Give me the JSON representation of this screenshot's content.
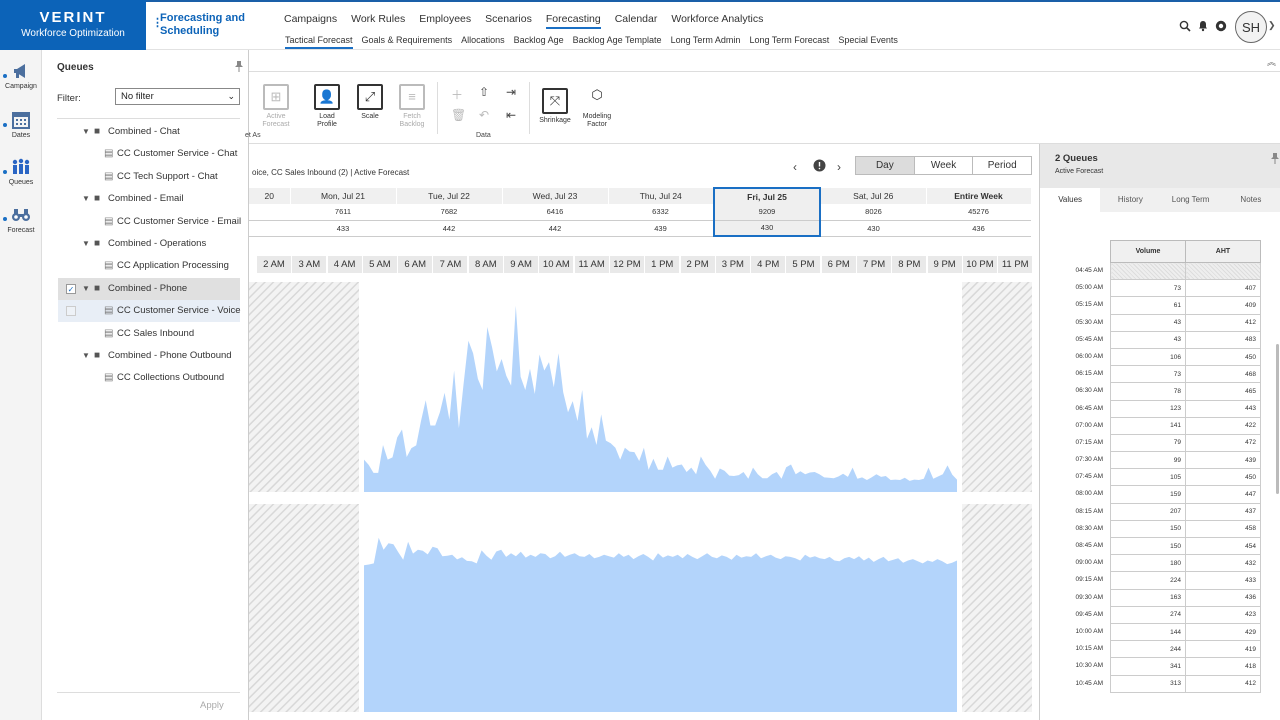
{
  "brand": {
    "name": "VERINT",
    "product": "Workforce Optimization"
  },
  "app_title": [
    "Forecasting and",
    "Scheduling"
  ],
  "main_nav": [
    "Campaigns",
    "Work Rules",
    "Employees",
    "Scenarios",
    "Forecasting",
    "Calendar",
    "Workforce Analytics"
  ],
  "main_nav_active": "Forecasting",
  "sub_nav": [
    "Tactical Forecast",
    "Goals & Requirements",
    "Allocations",
    "Backlog Age",
    "Backlog Age Template",
    "Long Term Admin",
    "Long Term Forecast",
    "Special Events"
  ],
  "sub_nav_active": "Tactical Forecast",
  "user_initials": "SH",
  "rail": [
    {
      "label": "Campaign",
      "icon": "megaphone-icon"
    },
    {
      "label": "Dates",
      "icon": "calendar-icon"
    },
    {
      "label": "Queues",
      "icon": "people-icon"
    },
    {
      "label": "Forecast",
      "icon": "binoculars-icon"
    }
  ],
  "queues": {
    "title": "Queues",
    "filter_label": "Filter:",
    "filter_value": "No filter",
    "apply_label": "Apply",
    "tree": [
      {
        "label": "Combined - Chat",
        "level": 0
      },
      {
        "label": "CC Customer Service - Chat",
        "level": 1
      },
      {
        "label": "CC Tech Support - Chat",
        "level": 1
      },
      {
        "label": "Combined - Email",
        "level": 0
      },
      {
        "label": "CC Customer Service - Email",
        "level": 1
      },
      {
        "label": "Combined - Operations",
        "level": 0
      },
      {
        "label": "CC Application Processing",
        "level": 1
      },
      {
        "label": "Combined - Phone",
        "level": 0,
        "checked": true
      },
      {
        "label": "CC Customer Service - Voice",
        "level": 1
      },
      {
        "label": "CC Sales Inbound",
        "level": 1
      },
      {
        "label": "Combined - Phone Outbound",
        "level": 0
      },
      {
        "label": "CC Collections Outbound",
        "level": 1
      }
    ]
  },
  "ribbon": {
    "set_as_fragment": "et As",
    "active_forecast": [
      "Active",
      "Forecast"
    ],
    "load_profile": [
      "Load",
      "Profile"
    ],
    "scale": "Scale",
    "fetch_backlog": [
      "Fetch",
      "Backlog"
    ],
    "data_group": "Data",
    "shrinkage": "Shrinkage",
    "modeling_factor": [
      "Modeling",
      "Factor"
    ]
  },
  "breadcrumb": "oice, CC Sales Inbound (2) | Active Forecast",
  "view_modes": [
    "Day",
    "Week",
    "Period"
  ],
  "view_mode_active": "Day",
  "week_table": {
    "headers": [
      "20",
      "Mon, Jul 21",
      "Tue, Jul 22",
      "Wed, Jul 23",
      "Thu, Jul 24",
      "Fri, Jul 25",
      "Sat, Jul 26",
      "Entire Week"
    ],
    "volume": [
      "",
      "7611",
      "7682",
      "6416",
      "6332",
      "9209",
      "8026",
      "45276"
    ],
    "aht": [
      "",
      "433",
      "442",
      "442",
      "439",
      "430",
      "430",
      "436"
    ],
    "selected_index": 5
  },
  "hours": [
    "2 AM",
    "3 AM",
    "4 AM",
    "5 AM",
    "6 AM",
    "7 AM",
    "8 AM",
    "9 AM",
    "10 AM",
    "11 AM",
    "12 PM",
    "1 PM",
    "2 PM",
    "3 PM",
    "4 PM",
    "5 PM",
    "6 PM",
    "7 PM",
    "8 PM",
    "9 PM",
    "10 PM",
    "11 PM"
  ],
  "chart_data": [
    {
      "type": "area",
      "x_start": "5:00 AM",
      "x_end": "9:45 PM",
      "x_step_minutes": 15,
      "color": "#b3d4fb",
      "values": [
        73,
        61,
        43,
        43,
        106,
        73,
        78,
        123,
        141,
        79,
        99,
        105,
        159,
        207,
        150,
        150,
        180,
        224,
        163,
        274,
        144,
        244,
        341,
        313,
        255,
        230,
        372,
        326,
        272,
        300,
        262,
        240,
        420,
        260,
        230,
        278,
        221,
        310,
        274,
        293,
        236,
        313,
        225,
        180,
        205,
        160,
        230,
        120,
        146,
        106,
        175,
        116,
        110,
        100,
        73,
        100,
        91,
        90,
        70,
        100,
        50,
        75,
        50,
        50,
        80,
        55,
        60,
        62,
        45,
        55,
        40,
        80,
        61,
        48,
        30,
        53,
        48,
        37,
        36,
        38,
        45,
        30,
        55,
        40,
        31,
        31,
        40,
        45,
        30,
        56,
        62,
        40,
        47,
        40,
        44,
        45,
        40,
        33,
        32,
        31,
        35,
        41,
        34,
        55,
        30,
        33,
        27,
        33,
        40,
        34,
        36,
        27,
        28,
        27,
        32,
        25,
        28,
        27,
        30,
        55,
        30,
        35,
        40,
        60,
        39,
        28
      ],
      "ylim": [
        0,
        460
      ]
    },
    {
      "type": "area",
      "x_start": "5:00 AM",
      "x_end": "9:45 PM",
      "x_step_minutes": 15,
      "color": "#b3d4fb",
      "values": [
        407,
        409,
        412,
        483,
        450,
        468,
        465,
        443,
        422,
        472,
        439,
        450,
        447,
        437,
        458,
        454,
        432,
        433,
        436,
        423,
        429,
        419,
        418,
        412,
        448,
        433,
        422,
        445,
        450,
        430,
        440,
        432,
        444,
        428,
        436,
        430,
        440,
        438,
        426,
        432,
        444,
        430,
        436,
        440,
        432,
        430,
        438,
        426,
        430,
        436,
        432,
        428,
        440,
        430,
        436,
        424,
        432,
        438,
        430,
        420,
        440,
        428,
        434,
        430,
        436,
        426,
        438,
        430,
        424,
        432,
        440,
        430,
        426,
        434,
        430,
        422,
        436,
        428,
        432,
        430,
        440,
        426,
        432,
        436,
        428,
        424,
        432,
        430,
        426,
        420,
        436,
        428,
        432,
        426,
        424,
        430,
        420,
        418,
        426,
        430,
        424,
        432,
        420,
        428,
        416,
        424,
        430,
        418,
        422,
        426,
        414,
        420,
        424,
        418,
        412,
        420,
        416,
        424,
        418,
        410,
        414,
        420
      ],
      "ylim": [
        0,
        560
      ]
    }
  ],
  "right_panel": {
    "title": "2 Queues",
    "subtitle": "Active Forecast",
    "tabs": [
      "Values",
      "History",
      "Long Term",
      "Notes"
    ],
    "active_tab": "Values",
    "col_volume": "Volume",
    "col_aht": "AHT",
    "rows": [
      {
        "time": "04:45 AM",
        "volume": "",
        "aht": ""
      },
      {
        "time": "05:00 AM",
        "volume": "73",
        "aht": "407"
      },
      {
        "time": "05:15 AM",
        "volume": "61",
        "aht": "409"
      },
      {
        "time": "05:30 AM",
        "volume": "43",
        "aht": "412"
      },
      {
        "time": "05:45 AM",
        "volume": "43",
        "aht": "483"
      },
      {
        "time": "06:00 AM",
        "volume": "106",
        "aht": "450"
      },
      {
        "time": "06:15 AM",
        "volume": "73",
        "aht": "468"
      },
      {
        "time": "06:30 AM",
        "volume": "78",
        "aht": "465"
      },
      {
        "time": "06:45 AM",
        "volume": "123",
        "aht": "443"
      },
      {
        "time": "07:00 AM",
        "volume": "141",
        "aht": "422"
      },
      {
        "time": "07:15 AM",
        "volume": "79",
        "aht": "472"
      },
      {
        "time": "07:30 AM",
        "volume": "99",
        "aht": "439"
      },
      {
        "time": "07:45 AM",
        "volume": "105",
        "aht": "450"
      },
      {
        "time": "08:00 AM",
        "volume": "159",
        "aht": "447"
      },
      {
        "time": "08:15 AM",
        "volume": "207",
        "aht": "437"
      },
      {
        "time": "08:30 AM",
        "volume": "150",
        "aht": "458"
      },
      {
        "time": "08:45 AM",
        "volume": "150",
        "aht": "454"
      },
      {
        "time": "09:00 AM",
        "volume": "180",
        "aht": "432"
      },
      {
        "time": "09:15 AM",
        "volume": "224",
        "aht": "433"
      },
      {
        "time": "09:30 AM",
        "volume": "163",
        "aht": "436"
      },
      {
        "time": "09:45 AM",
        "volume": "274",
        "aht": "423"
      },
      {
        "time": "10:00 AM",
        "volume": "144",
        "aht": "429"
      },
      {
        "time": "10:15 AM",
        "volume": "244",
        "aht": "419"
      },
      {
        "time": "10:30 AM",
        "volume": "341",
        "aht": "418"
      },
      {
        "time": "10:45 AM",
        "volume": "313",
        "aht": "412"
      }
    ]
  }
}
